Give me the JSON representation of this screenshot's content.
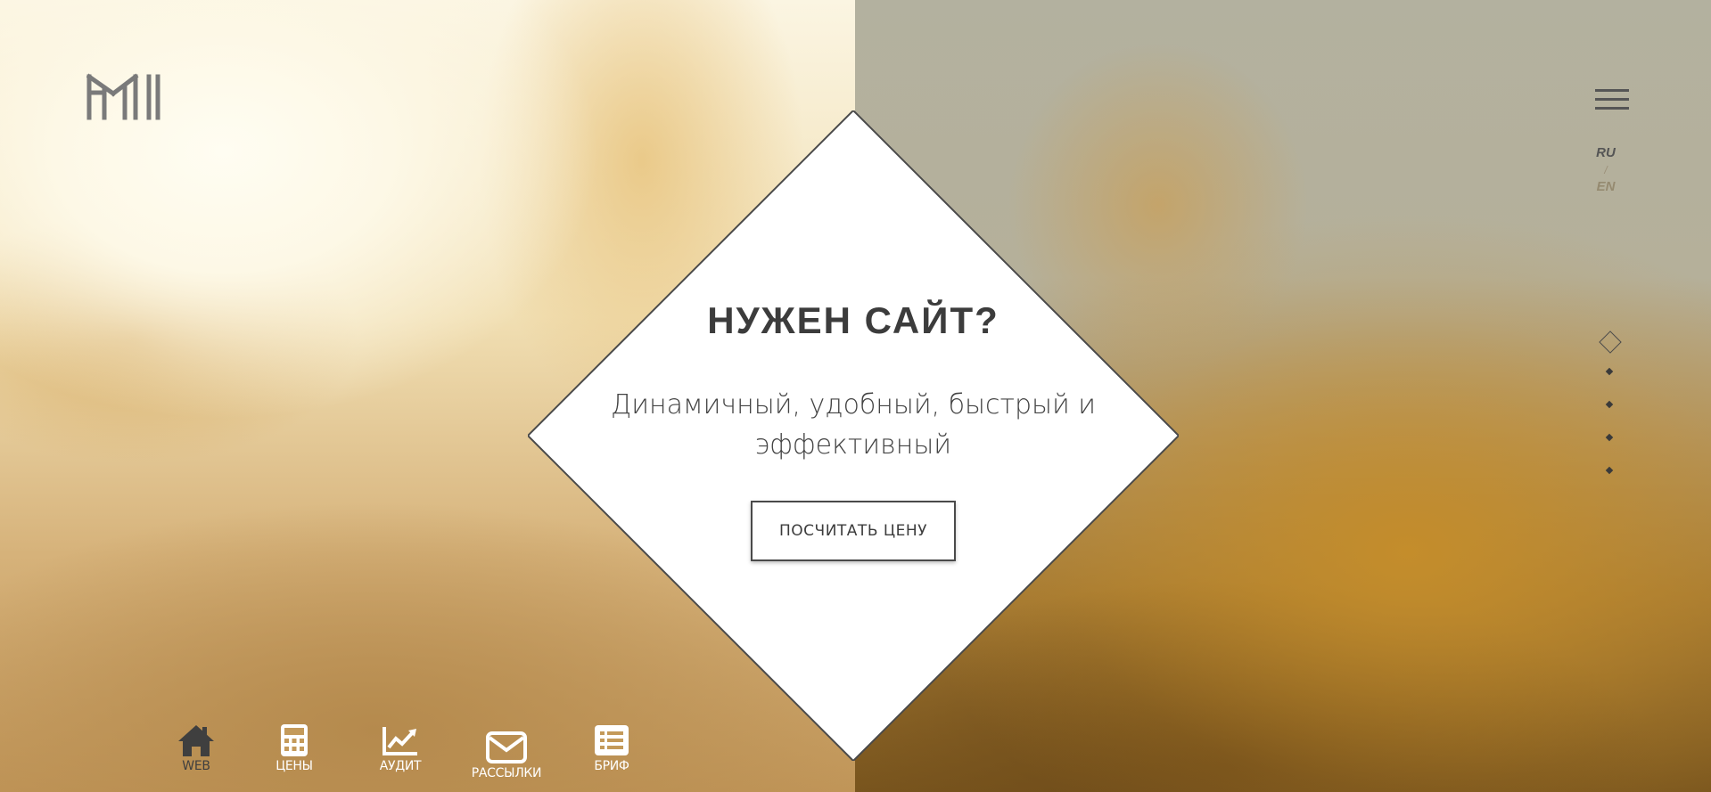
{
  "header": {
    "logo_alt": "NM",
    "menu_icon": "hamburger-icon"
  },
  "language": {
    "current": "RU",
    "separator": "/",
    "other": "EN"
  },
  "hero": {
    "title": "НУЖЕН САЙТ?",
    "subtitle": "Динамичный, удобный, быстрый и эффективный",
    "cta_label": "ПОСЧИТАТЬ ЦЕНУ"
  },
  "pager": {
    "total": 5,
    "active_index": 0
  },
  "bottom_nav": {
    "items": [
      {
        "label": "WEB",
        "icon": "home-icon"
      },
      {
        "label": "ЦЕНЫ",
        "icon": "calculator-icon"
      },
      {
        "label": "АУДИТ",
        "icon": "chart-line-icon"
      },
      {
        "label": "РАССЫЛКИ",
        "icon": "envelope-icon"
      },
      {
        "label": "БРИФ",
        "icon": "list-icon"
      }
    ]
  },
  "colors": {
    "text_dark": "#3c3c3c",
    "nav_light": "#ffffff",
    "diamond_fill": "#ffffff",
    "diamond_border": "#4a4a4a"
  }
}
